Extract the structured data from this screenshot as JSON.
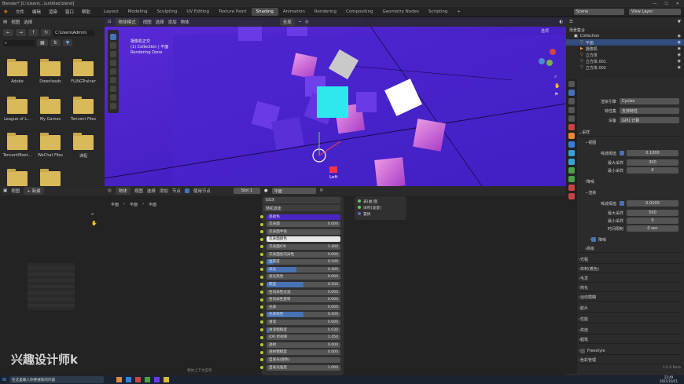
{
  "window": {
    "title": "Blender* [C:\\Users\\...\\untitled.blend]"
  },
  "menu": {
    "items": [
      "文件",
      "编辑",
      "渲染",
      "窗口",
      "帮助"
    ]
  },
  "workspaces": [
    "Layout",
    "Modeling",
    "Sculpting",
    "UV Editing",
    "Texture Paint",
    "Shading",
    "Animation",
    "Rendering",
    "Compositing",
    "Geometry Nodes",
    "Scripting"
  ],
  "workspace_active": "Shading",
  "scene": {
    "label": "Scene",
    "view_layer": "View Layer"
  },
  "filebrowser": {
    "header": [
      "视图",
      "选择"
    ],
    "path": "C:\\Users\\Admin\\",
    "folders": [
      "Adobe",
      "Downloads",
      "FLiNGTrainer",
      "League of L...",
      "My Games",
      "Tencent Files",
      "TencentMeet...",
      "WeChat Files",
      "课程"
    ]
  },
  "viewport": {
    "mode": "物体模式",
    "menu": [
      "视图",
      "选择",
      "添加",
      "物体"
    ],
    "shading": "全局",
    "camera_label": "摄像机正交",
    "collection_label": "(1) Collection | 平面",
    "status": "Rendering Done",
    "view_name": "Left",
    "options": "选项"
  },
  "outliner": {
    "title": "场景集合",
    "items": [
      "Collection",
      "平面",
      "摄像机",
      "立方体",
      "立方体.001",
      "立方体.002"
    ]
  },
  "props": {
    "section_render_engine": {
      "label": "渲染引擎",
      "value": "Cycles"
    },
    "feature_set": {
      "label": "特性集",
      "value": "支持特性"
    },
    "device": {
      "label": "设备",
      "value": "GPU 计算"
    },
    "sampling": "采样",
    "viewport": "视图",
    "viewport_noise": {
      "label": "噪波阈值",
      "value": "0.1000"
    },
    "viewport_max": {
      "label": "最大采样",
      "value": "300"
    },
    "viewport_min": {
      "label": "最小采样",
      "value": "0"
    },
    "denoise1": "降噪",
    "render": "渲染",
    "render_noise": {
      "label": "噪波阈值",
      "value": "0.0100"
    },
    "render_max": {
      "label": "最大采样",
      "value": "500"
    },
    "render_min": {
      "label": "最小采样",
      "value": "0"
    },
    "time_limit": {
      "label": "时间限制",
      "value": "0 sec"
    },
    "denoise2": "降噪",
    "advanced": "高级",
    "panels": [
      "光程",
      "体积(着色)",
      "毛发",
      "简化",
      "运动模糊",
      "胶片",
      "性能",
      "烘焙",
      "蜡笔",
      "Freestyle",
      "色彩管理"
    ],
    "version": "3.0.0 Beta"
  },
  "nodeeditor": {
    "header": [
      "物体",
      "视图",
      "选择",
      "添加",
      "节点"
    ],
    "use_nodes": "使用节点",
    "slot": "Slot 1",
    "material": "平面",
    "breadcrumb": [
      "平面",
      "平面",
      "平面"
    ],
    "bsdf": {
      "distribution": "GGX",
      "subsurface_method": "随机游走",
      "rows": [
        {
          "label": "基础色",
          "value": "",
          "fill": 0
        },
        {
          "label": "次表面",
          "value": "0.000",
          "fill": 0
        },
        {
          "label": "次表面半径",
          "value": "",
          "fill": 0
        },
        {
          "label": "次表面颜色",
          "value": "",
          "fill": 0
        },
        {
          "label": "次表面IOR",
          "value": "1.400",
          "fill": 0
        },
        {
          "label": "次表面各向异性",
          "value": "0.000",
          "fill": 0
        },
        {
          "label": "金属度",
          "value": "0.100",
          "fill": 0.1
        },
        {
          "label": "高光",
          "value": "0.400",
          "fill": 0.4
        },
        {
          "label": "高光染色",
          "value": "0.000",
          "fill": 0
        },
        {
          "label": "糙度",
          "value": "0.500",
          "fill": 0.5
        },
        {
          "label": "各向异性过滤",
          "value": "0.000",
          "fill": 0
        },
        {
          "label": "各向异性旋转",
          "value": "0.000",
          "fill": 0
        },
        {
          "label": "光泽",
          "value": "0.000",
          "fill": 0
        },
        {
          "label": "光泽染色",
          "value": "0.500",
          "fill": 0.5
        },
        {
          "label": "清漆",
          "value": "0.000",
          "fill": 0
        },
        {
          "label": "清漆粗糙度",
          "value": "0.030",
          "fill": 0.03
        },
        {
          "label": "IOR 折射率",
          "value": "1.450",
          "fill": 0
        },
        {
          "label": "透射",
          "value": "0.000",
          "fill": 0
        },
        {
          "label": "透射粗糙度",
          "value": "0.000",
          "fill": 0
        },
        {
          "label": "自发光(颜色)",
          "value": "",
          "fill": 0
        },
        {
          "label": "自发光强度",
          "value": "1.000",
          "fill": 0
        }
      ]
    },
    "output": {
      "items": [
        "表(曲)面",
        "体积(容量)",
        "置换"
      ]
    }
  },
  "bottomleft": {
    "header": [
      "视图"
    ],
    "new_button": "新建"
  },
  "statusbar": {
    "hint": "物体上下文菜单"
  },
  "watermark": "兴趣设计师k",
  "taskbar": {
    "search": "在这里输入你要搜索的内容",
    "time": "12:49",
    "date": "2021/10/21"
  },
  "colors": {
    "viewport_bg": "#4121c6",
    "accent": "#4772b3",
    "cyan": "#2ee8f0"
  }
}
